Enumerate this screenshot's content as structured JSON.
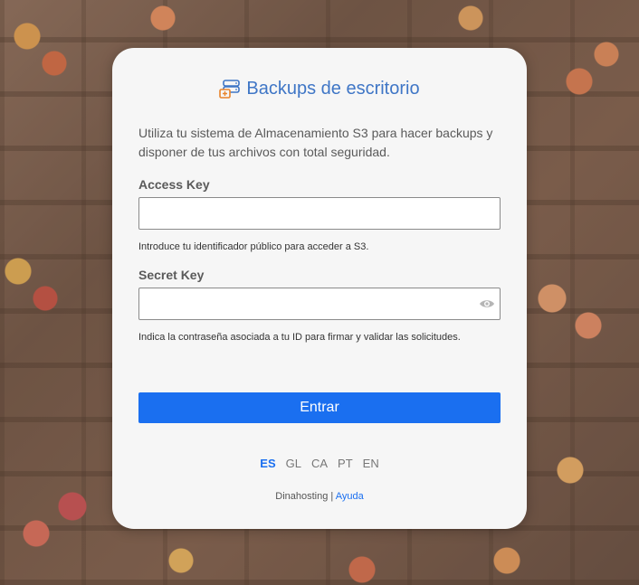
{
  "brand": {
    "title": "Backups de escritorio",
    "icon": "server-backup-icon",
    "accent_color": "#3f76c6"
  },
  "intro": "Utiliza tu sistema de Almacenamiento S3 para hacer backups y disponer de tus archivos con total seguridad.",
  "access_key": {
    "label": "Access Key",
    "value": "",
    "placeholder": "",
    "help": "Introduce tu identificador público para acceder a S3."
  },
  "secret_key": {
    "label": "Secret Key",
    "value": "",
    "placeholder": "",
    "help": "Indica la contraseña asociada a tu ID para firmar y validar las solicitudes.",
    "toggle_icon": "eye-icon"
  },
  "submit": {
    "label": "Entrar",
    "color": "#1a6ff0"
  },
  "languages": [
    {
      "code": "ES",
      "active": true
    },
    {
      "code": "GL",
      "active": false
    },
    {
      "code": "CA",
      "active": false
    },
    {
      "code": "PT",
      "active": false
    },
    {
      "code": "EN",
      "active": false
    }
  ],
  "footer": {
    "company": "Dinahosting",
    "separator": "|",
    "help_link": "Ayuda"
  }
}
